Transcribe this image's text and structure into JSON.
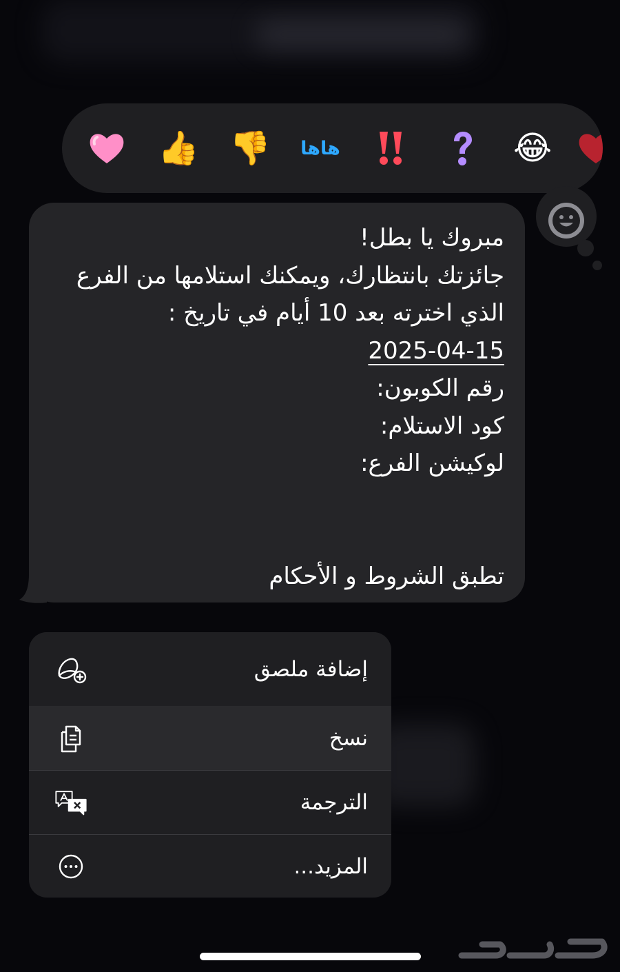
{
  "reactions": [
    {
      "name": "heart",
      "glyph": "💗"
    },
    {
      "name": "thumbs-up",
      "glyph": "👍"
    },
    {
      "name": "thumbs-down",
      "glyph": "👎"
    },
    {
      "name": "haha",
      "label": "هاها"
    },
    {
      "name": "emphasize",
      "glyph": "‼️"
    },
    {
      "name": "question",
      "glyph": "❓"
    },
    {
      "name": "laugh-tears",
      "glyph": "😂"
    },
    {
      "name": "partial",
      "glyph": "❤️"
    }
  ],
  "add_reaction_icon": "smiley-icon",
  "message": {
    "line1": "مبروك يا بطل!",
    "line2": "جائزتك بانتظارك، ويمكنك استلامها من الفرع",
    "line3": "الذي اخترته بعد 10 أيام في تاريخ :",
    "date": "2025-04-15",
    "coupon_label": "رقم الكوبون:",
    "pickup_label": "كود الاستلام:",
    "location_label": "لوكيشن الفرع:",
    "terms": "تطبق الشروط و الأحكام"
  },
  "context_menu": {
    "add_sticker": "إضافة ملصق",
    "copy": "نسخ",
    "translate": "الترجمة",
    "more": "المزيد..."
  },
  "colors": {
    "background": "#07070b",
    "bubble": "#252528",
    "menu": "#1f1f22",
    "haha": "#2ea8ff"
  }
}
